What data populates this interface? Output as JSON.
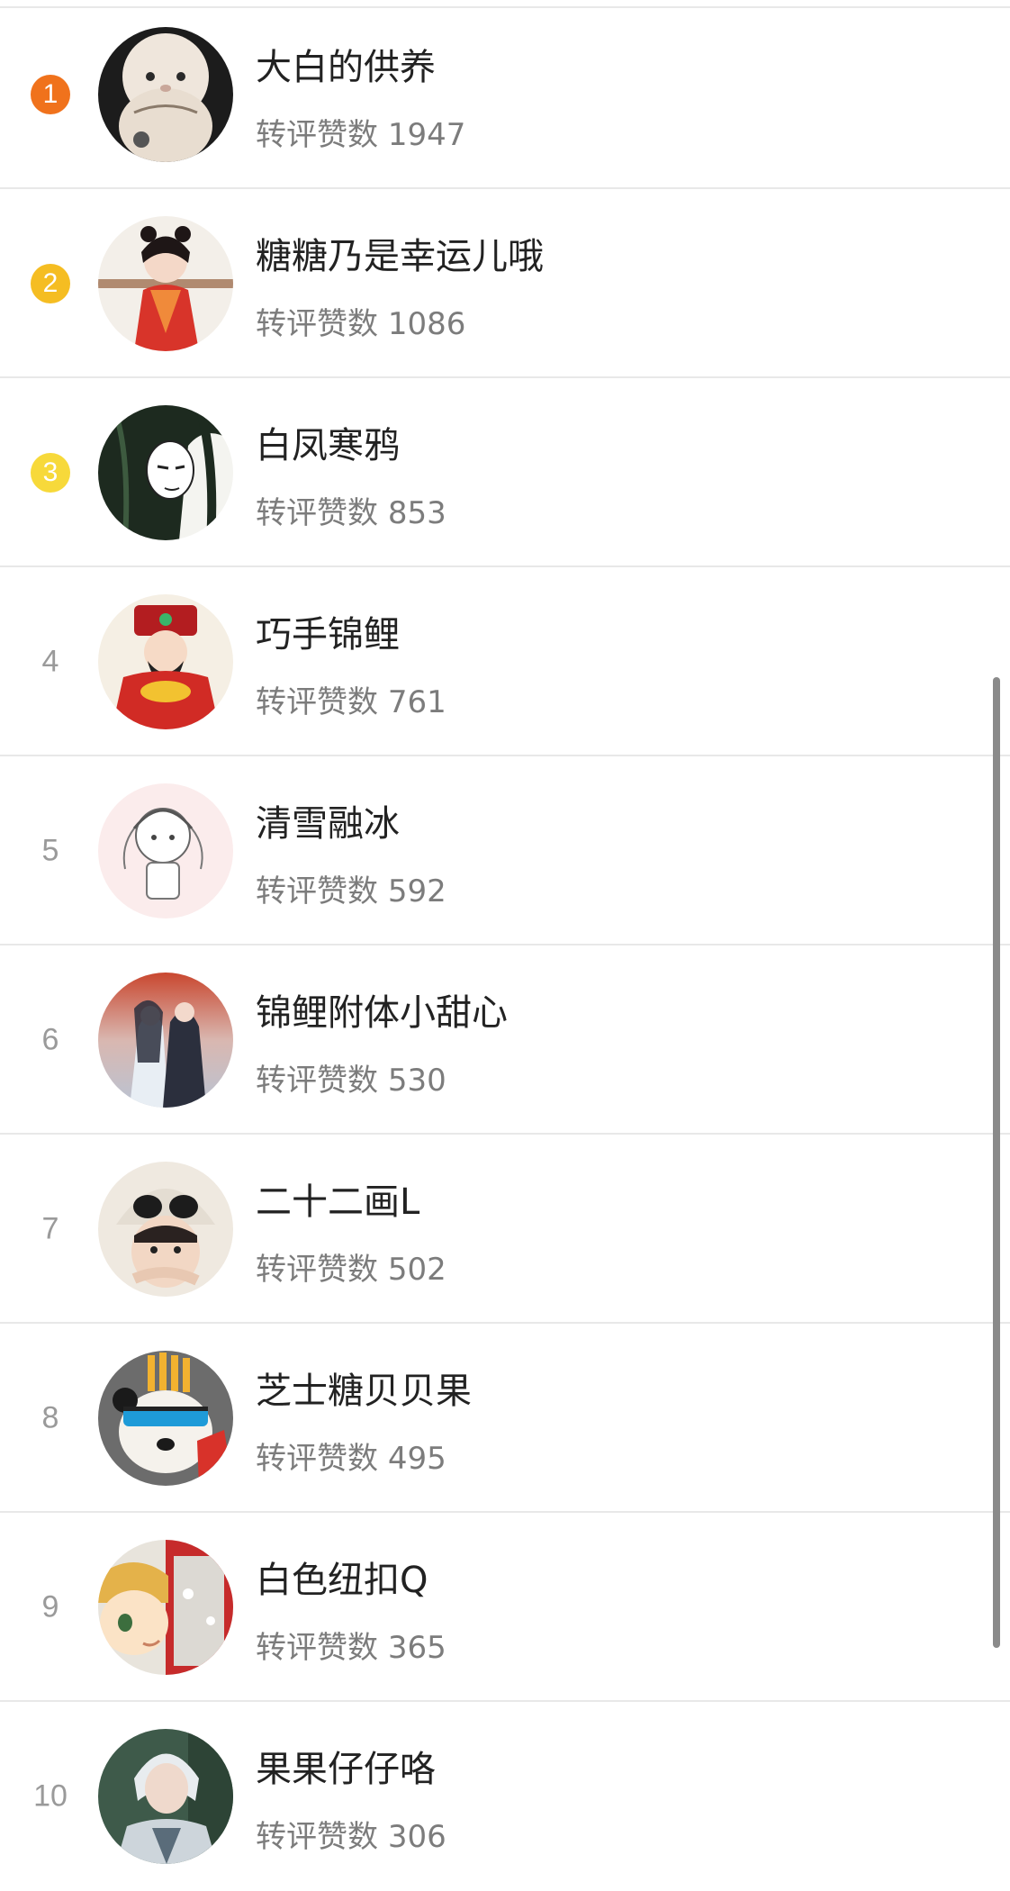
{
  "stat_label": "转评赞数",
  "colors": {
    "rank1": "#f0721c",
    "rank2": "#f5bd22",
    "rank3": "#f7d93a",
    "divider": "#e8e8e8",
    "name_text": "#222222",
    "stat_text": "#7c7c7c"
  },
  "items": [
    {
      "rank": "1",
      "name": "大白的供养",
      "count": "1947",
      "avatar": "fluffy-white-plush-avatar"
    },
    {
      "rank": "2",
      "name": "糖糖乃是幸运儿哦",
      "count": "1086",
      "avatar": "red-dress-girl-avatar"
    },
    {
      "rank": "3",
      "name": "白凤寒鸦",
      "count": "853",
      "avatar": "ink-sketch-character-avatar"
    },
    {
      "rank": "4",
      "name": "巧手锦鲤",
      "count": "761",
      "avatar": "god-of-wealth-avatar"
    },
    {
      "rank": "5",
      "name": "清雪融冰",
      "count": "592",
      "avatar": "sketch-chibi-girl-avatar"
    },
    {
      "rank": "6",
      "name": "锦鲤附体小甜心",
      "count": "530",
      "avatar": "anime-couple-avatar"
    },
    {
      "rank": "7",
      "name": "二十二画L",
      "count": "502",
      "avatar": "boy-panda-hat-avatar"
    },
    {
      "rank": "8",
      "name": "芝士糖贝贝果",
      "count": "495",
      "avatar": "panda-sunglasses-avatar"
    },
    {
      "rank": "9",
      "name": "白色纽扣Q",
      "count": "365",
      "avatar": "cartoon-boy-phone-booth-avatar"
    },
    {
      "rank": "10",
      "name": "果果仔仔咯",
      "count": "306",
      "avatar": "white-hair-warrior-avatar"
    }
  ]
}
